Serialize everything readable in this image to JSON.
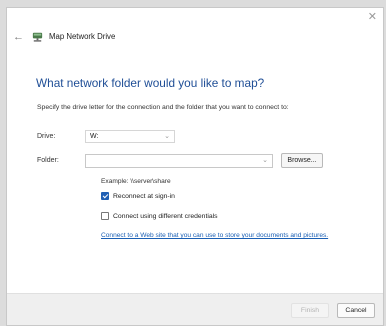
{
  "window": {
    "title": "Map Network Drive",
    "close_glyph": "✕",
    "back_glyph": "←"
  },
  "main": {
    "heading": "What network folder would you like to map?",
    "instructions": "Specify the drive letter for the connection and the folder that you want to connect to:",
    "drive_label": "Drive:",
    "drive_value": "W:",
    "folder_label": "Folder:",
    "folder_value": "",
    "browse_label": "Browse...",
    "example": "Example: \\\\server\\share",
    "reconnect_label": "Reconnect at sign-in",
    "reconnect_checked": true,
    "credentials_label": "Connect using different credentials",
    "credentials_checked": false,
    "link_text": "Connect to a Web site that you can use to store your documents and pictures."
  },
  "footer": {
    "finish_label": "Finish",
    "cancel_label": "Cancel"
  },
  "icons": {
    "title": "network-drive-icon",
    "chevron": "chevron-down-icon"
  },
  "colors": {
    "heading": "#1f4e96",
    "link": "#1a5fb4",
    "checkbox": "#1f5fb4"
  }
}
